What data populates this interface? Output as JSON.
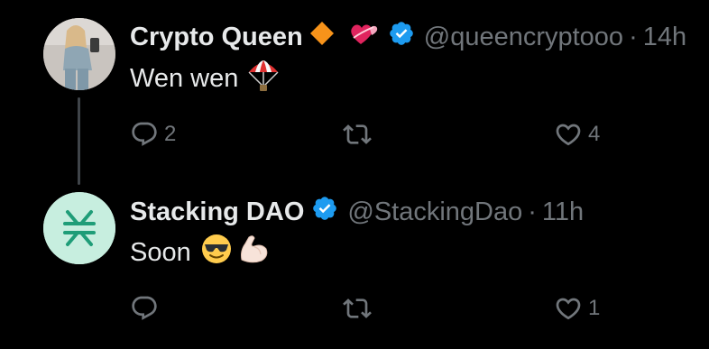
{
  "tweets": [
    {
      "name": "Crypto Queen",
      "handle": "@queencryptooo",
      "separator": "·",
      "time": "14h",
      "text": "Wen wen",
      "name_badges": [
        "orange-diamond-icon",
        "heart-with-ribbon-icon",
        "verified-badge-icon"
      ],
      "text_emoji": [
        "parachute-icon"
      ],
      "reply_count": "2",
      "retweet_count": "",
      "like_count": "4"
    },
    {
      "name": "Stacking DAO",
      "handle": "@StackingDao",
      "separator": "·",
      "time": "11h",
      "text": "Soon",
      "name_badges": [
        "verified-badge-icon"
      ],
      "text_emoji": [
        "sunglasses-face-icon",
        "flexed-biceps-icon"
      ],
      "reply_count": "",
      "retweet_count": "",
      "like_count": "1"
    }
  ],
  "colors": {
    "background": "#000000",
    "text": "#e7e9ea",
    "muted": "#71767b",
    "verified": "#1d9bf0",
    "stacks_avatar_bg": "#c7eedf",
    "stacks_logo": "#1f9d78"
  }
}
